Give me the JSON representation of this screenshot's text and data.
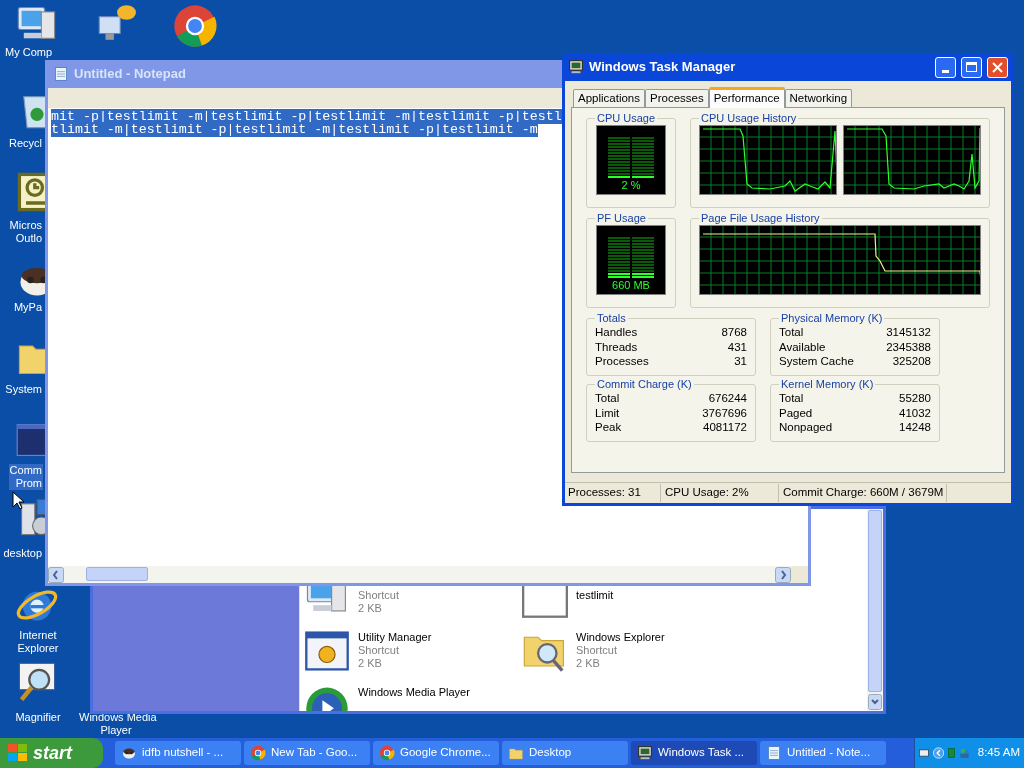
{
  "desktop_icons": [
    {
      "kind": "computer",
      "lines": [
        "My Comp"
      ],
      "selected": false
    },
    {
      "kind": "recycle",
      "lines": [
        "Recycl"
      ],
      "selected": false
    },
    {
      "kind": "outlook",
      "lines": [
        "Micros",
        "Outlo"
      ],
      "selected": false
    },
    {
      "kind": "raccoon",
      "lines": [
        "MyPa"
      ],
      "selected": false
    },
    {
      "kind": "folder",
      "lines": [
        "System"
      ],
      "selected": false
    },
    {
      "kind": "console",
      "lines": [
        "Comm",
        "Prom"
      ],
      "selected": true
    },
    {
      "kind": "setup",
      "lines": [
        "desktop"
      ],
      "selected": false
    },
    {
      "kind": "ie",
      "lines": [
        "Internet",
        "Explorer"
      ],
      "selected": false
    },
    {
      "kind": "magnifier",
      "lines": [
        "Magnifier"
      ],
      "selected": false
    },
    {
      "kind": "none",
      "lines": [
        "Windows Media",
        "Player"
      ],
      "selected": false
    }
  ],
  "explorer": {
    "items": [
      {
        "kind": "computer",
        "type": "Shortcut",
        "size": "2 KB"
      },
      {
        "kind": "blank",
        "name": "testlimit"
      },
      {
        "kind": "utility",
        "name": "Utility Manager",
        "type": "Shortcut",
        "size": "2 KB"
      },
      {
        "kind": "search-folder",
        "name": "Windows Explorer",
        "type": "Shortcut",
        "size": "2 KB"
      },
      {
        "kind": "media",
        "name": "Windows Media Player"
      }
    ]
  },
  "notepad": {
    "title": "Untitled - Notepad",
    "lines": [
      "mit -p|testlimit -m|testlimit -p|testlimit -m|testlimit -p|testl",
      "tlimit -m|testlimit -p|testlimit -m|testlimit -p|testlimit -m"
    ],
    "text_selected": true
  },
  "task_manager": {
    "title": "Windows Task Manager",
    "tabs": [
      {
        "label": "Applications",
        "selected": false
      },
      {
        "label": "Processes",
        "selected": false
      },
      {
        "label": "Performance",
        "selected": true
      },
      {
        "label": "Networking",
        "selected": false
      }
    ],
    "cpu_usage": {
      "label": "CPU Usage",
      "reading": "2 %"
    },
    "cpu_history": {
      "label": "CPU Usage History"
    },
    "pf_usage": {
      "label": "PF Usage",
      "reading": "660 MB"
    },
    "pf_history": {
      "label": "Page File Usage History"
    },
    "groups": [
      {
        "title": "Totals",
        "rows": [
          {
            "name": "Handles",
            "value": "8768"
          },
          {
            "name": "Threads",
            "value": "431"
          },
          {
            "name": "Processes",
            "value": "31"
          }
        ]
      },
      {
        "title": "Physical Memory (K)",
        "rows": [
          {
            "name": "Total",
            "value": "3145132"
          },
          {
            "name": "Available",
            "value": "2345388"
          },
          {
            "name": "System Cache",
            "value": "325208"
          }
        ]
      },
      {
        "title": "Commit Charge (K)",
        "rows": [
          {
            "name": "Total",
            "value": "676244"
          },
          {
            "name": "Limit",
            "value": "3767696"
          },
          {
            "name": "Peak",
            "value": "4081172"
          }
        ]
      },
      {
        "title": "Kernel Memory (K)",
        "rows": [
          {
            "name": "Total",
            "value": "55280"
          },
          {
            "name": "Paged",
            "value": "41032"
          },
          {
            "name": "Nonpaged",
            "value": "14248"
          }
        ]
      }
    ],
    "status_bar": [
      "Processes: 31",
      "CPU Usage: 2%",
      "Commit Charge: 660M / 3679M"
    ]
  },
  "taskbar": {
    "start": "start",
    "buttons": [
      {
        "kind": "raccoon",
        "label": "idfb nutshell - ...",
        "selected": false
      },
      {
        "kind": "chrome",
        "label": "New Tab - Goo...",
        "selected": false
      },
      {
        "kind": "chrome",
        "label": "Google Chrome...",
        "selected": false
      },
      {
        "kind": "folder",
        "label": "Desktop",
        "selected": false
      },
      {
        "kind": "taskmgr",
        "label": "Windows Task ...",
        "selected": true
      },
      {
        "kind": "notepad",
        "label": "Untitled - Note...",
        "selected": false
      }
    ],
    "clock": "8:45 AM"
  }
}
